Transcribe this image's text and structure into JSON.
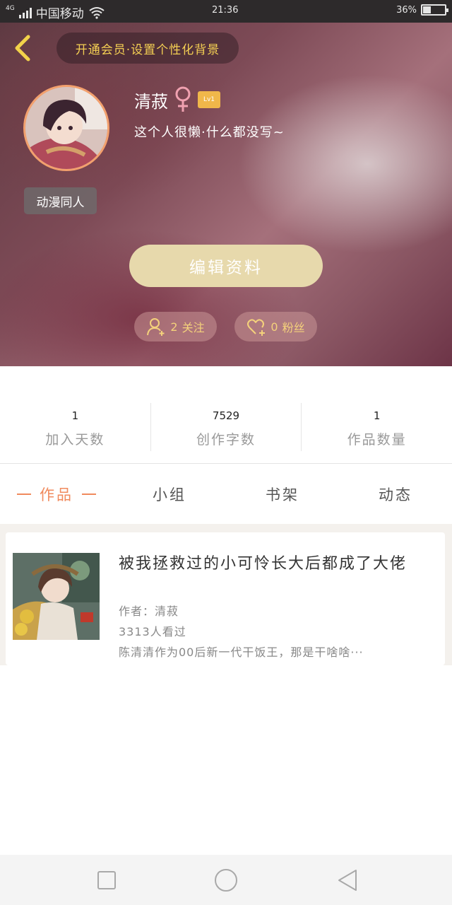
{
  "status_bar": {
    "network_type": "4G",
    "carrier": "中国移动",
    "time": "21:36",
    "battery_text": "36%",
    "battery_level": 0.36,
    "icons": [
      "signal-icon",
      "wifi-icon",
      "battery-icon"
    ]
  },
  "header": {
    "vip_banner": "开通会员·设置个性化背景",
    "username": "清菽",
    "level": "Lv1",
    "bio": "这个人很懒·什么都没写~",
    "tag": "动漫同人",
    "edit_button": "编辑资料",
    "follow_count": "2",
    "follow_label": "关注",
    "fans_count": "0",
    "fans_label": "粉丝",
    "colors": {
      "back_arrow": "#f2d24a",
      "vip_text": "#f4cf53",
      "edit_button_bg": "#e7d9ac",
      "gender_icon": "#f0a1b0",
      "level_badge": "#f0b74a"
    }
  },
  "stats": [
    {
      "value": "1",
      "label": "加入天数"
    },
    {
      "value": "7529",
      "label": "创作字数"
    },
    {
      "value": "1",
      "label": "作品数量"
    }
  ],
  "tabs": [
    {
      "label": "作品",
      "active": true
    },
    {
      "label": "小组",
      "active": false
    },
    {
      "label": "书架",
      "active": false
    },
    {
      "label": "动态",
      "active": false
    }
  ],
  "works": [
    {
      "title": "被我拯救过的小可怜长大后都成了大佬",
      "author": "作者：清菽",
      "views": "3313人看过",
      "summary": "陈清清作为00后新一代干饭王，那是干啥啥···"
    }
  ],
  "accent_color": "#f08a5d"
}
